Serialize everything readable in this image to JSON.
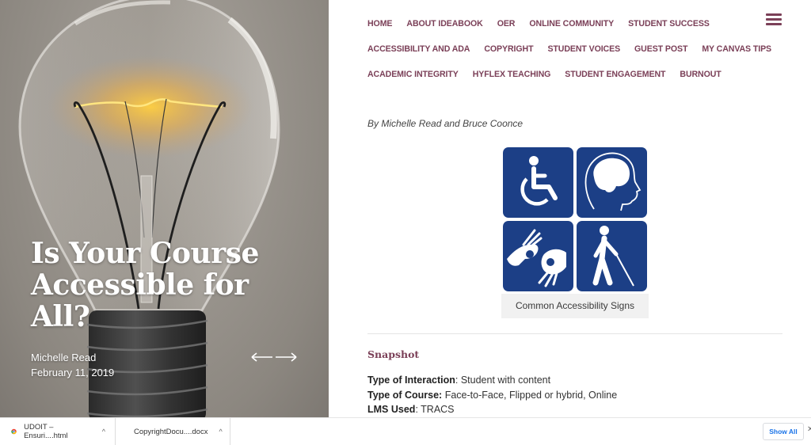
{
  "hero": {
    "title": "Is Your Course Accessible for All?",
    "author": "Michelle Read",
    "date": "February 11, 2019",
    "nav_arrows_icon": "left-right-arrows-icon"
  },
  "nav": {
    "rows": [
      [
        "HOME",
        "ABOUT IDEABOOK",
        "OER",
        "ONLINE COMMUNITY",
        "STUDENT SUCCESS"
      ],
      [
        "ACCESSIBILITY AND ADA",
        "COPYRIGHT",
        "STUDENT VOICES",
        "GUEST POST",
        "MY CANVAS TIPS"
      ],
      [
        "ACADEMIC INTEGRITY",
        "HYFLEX TEACHING",
        "STUDENT ENGAGEMENT",
        "BURNOUT"
      ]
    ],
    "menu_icon": "hamburger-menu-icon"
  },
  "article": {
    "byline": "By Michelle Read and Bruce Coonce",
    "figure": {
      "signs": [
        "wheelchair-icon",
        "cognitive-brain-icon",
        "sign-language-icon",
        "blind-cane-icon"
      ],
      "caption": "Common Accessibility Signs"
    },
    "snapshot": {
      "title": "Snapshot",
      "items": [
        {
          "label": "Type of Interaction",
          "value": ": Student with content"
        },
        {
          "label": "Type of Course:",
          "value": " Face-to-Face, Flipped or hybrid, Online"
        },
        {
          "label": "LMS Used",
          "value": ": TRACS"
        }
      ]
    }
  },
  "downloads": {
    "items": [
      {
        "name": "UDOIT – Ensuri....html",
        "icon": "chrome-file-icon"
      },
      {
        "name": "CopyrightDocu....docx",
        "icon": "word-doc-icon"
      }
    ],
    "show_all": "Show All",
    "caret": "^"
  },
  "colors": {
    "accent": "#7b4058",
    "sign_blue": "#1c3f86"
  }
}
